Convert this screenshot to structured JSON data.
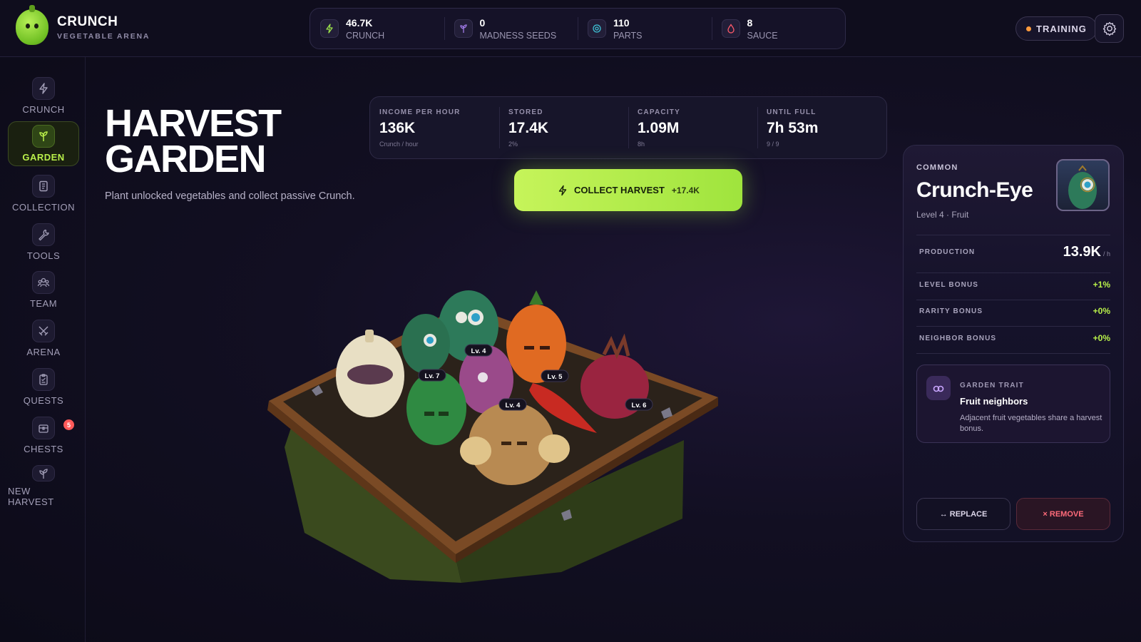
{
  "brand": {
    "name": "CRUNCH",
    "subtitle": "VEGETABLE ARENA"
  },
  "resources": [
    {
      "value": "46.7K",
      "label": "CRUNCH",
      "icon": "bolt-icon",
      "color": "#9be24a"
    },
    {
      "value": "0",
      "label": "MADNESS SEEDS",
      "icon": "sprout-icon",
      "color": "#a07ae8"
    },
    {
      "value": "110",
      "label": "PARTS",
      "icon": "target-icon",
      "color": "#3ec2d6"
    },
    {
      "value": "8",
      "label": "SAUCE",
      "icon": "drop-icon",
      "color": "#ff5a6a"
    }
  ],
  "header": {
    "training_label": "TRAINING",
    "training_dot_color": "#ff9a3c",
    "settings_icon": "gear-icon"
  },
  "sidebar": {
    "items": [
      {
        "label": "CRUNCH",
        "icon": "bolt-icon",
        "active": false
      },
      {
        "label": "GARDEN",
        "icon": "sprout-icon",
        "active": true
      },
      {
        "label": "COLLECTION",
        "icon": "book-icon",
        "active": false
      },
      {
        "label": "TOOLS",
        "icon": "wrench-icon",
        "active": false
      },
      {
        "label": "TEAM",
        "icon": "team-icon",
        "active": false
      },
      {
        "label": "ARENA",
        "icon": "swords-icon",
        "active": false
      },
      {
        "label": "QUESTS",
        "icon": "clipboard-icon",
        "active": false
      },
      {
        "label": "CHESTS",
        "icon": "chest-icon",
        "active": false,
        "badge": "5"
      },
      {
        "label": "NEW HARVEST",
        "icon": "plant-icon",
        "active": false
      }
    ]
  },
  "main": {
    "title_line1": "HARVEST",
    "title_line2": "GARDEN",
    "subtitle": "Plant unlocked vegetables and collect passive Crunch.",
    "stats": [
      {
        "label": "INCOME PER HOUR",
        "value": "136K",
        "sub": "Crunch / hour"
      },
      {
        "label": "STORED",
        "value": "17.4K",
        "sub": "2%"
      },
      {
        "label": "CAPACITY",
        "value": "1.09M",
        "sub": "8h"
      },
      {
        "label": "UNTIL FULL",
        "value": "7h 53m",
        "sub": "9 / 9"
      }
    ],
    "collect_button": {
      "label": "COLLECT HARVEST",
      "bonus": "+17.4K"
    },
    "garden_levels": [
      "Lv. 4",
      "Lv. 7",
      "Lv. 5",
      "Lv. 4",
      "Lv. 6"
    ]
  },
  "panel": {
    "rarity": "COMMON",
    "name": "Crunch-Eye",
    "meta": "Level 4 · Fruit",
    "production_label": "PRODUCTION",
    "production_value": "13.9K",
    "production_unit": "/ h",
    "bonuses": [
      {
        "label": "LEVEL BONUS",
        "value": "+1%"
      },
      {
        "label": "RARITY BONUS",
        "value": "+0%"
      },
      {
        "label": "NEIGHBOR BONUS",
        "value": "+0%"
      }
    ],
    "trait": {
      "kicker": "GARDEN TRAIT",
      "title": "Fruit neighbors",
      "description": "Adjacent fruit vegetables share a harvest bonus."
    },
    "replace_label": "↔ REPLACE",
    "remove_label": "× REMOVE"
  },
  "colors": {
    "accent": "#b9f04a",
    "danger": "#ff6b7a",
    "background": "#120f22"
  }
}
